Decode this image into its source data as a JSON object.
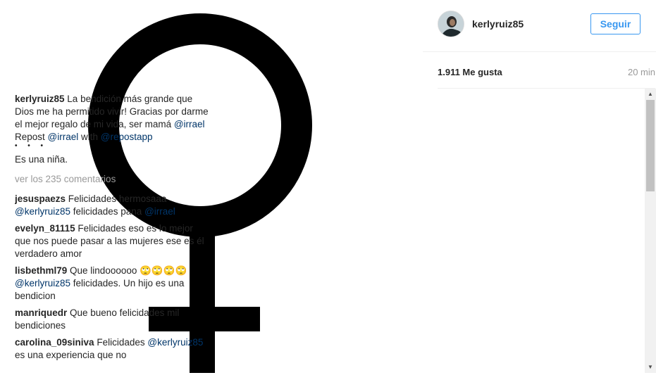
{
  "post": {
    "image_icon": "female-symbol-icon"
  },
  "header": {
    "username": "kerlyruiz85",
    "follow_label": "Seguir"
  },
  "stats": {
    "likes": "1.911 Me gusta",
    "time": "20 min"
  },
  "caption": {
    "username": "kerlyruiz85",
    "text_1": " La bendición más grande que Dios me ha permitido vivir! Gracias por darme el mejor regalo de mi vida, ser mamá ",
    "mention_1": "@irrael",
    "text_2": " Repost ",
    "mention_2": "@irrael",
    "text_3": " with ",
    "mention_3": "@repostapp",
    "dots": "• • •",
    "extra": "Es una niña."
  },
  "view_all": "ver los 235 comentarios",
  "comments": [
    {
      "username": "jesuspaezs",
      "text_1": " Felicidades hermosaaa ",
      "mention_1": "@kerlyruiz85",
      "text_2": " felicidades pana ",
      "mention_2": "@irrael"
    },
    {
      "username": "evelyn_81115",
      "text_1": " Felicidades eso es lo mejor que nos puede pasar a las mujeres ese es él verdadero amor"
    },
    {
      "username": "lisbethml79",
      "text_1": " Que lindoooooo 🙄🙄🙄🙄 ",
      "mention_1": "@kerlyruiz85",
      "text_2": " felicidades. Un hijo es una bendicion"
    },
    {
      "username": "manriquedr",
      "text_1": " Que bueno felicidades mil bendiciones"
    },
    {
      "username": "carolina_09siniva",
      "text_1": " Felicidades ",
      "mention_1": "@kerlyruiz85",
      "text_2": " es una experiencia que no"
    }
  ],
  "scrollbar": {
    "up_icon": "▲",
    "down_icon": "▼"
  }
}
